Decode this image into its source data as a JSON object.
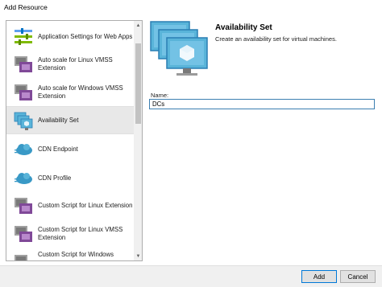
{
  "window": {
    "title": "Add Resource"
  },
  "resource_list": {
    "items": [
      {
        "label": "Application Settings for Web Apps",
        "icon": "app-settings-icon",
        "selected": false
      },
      {
        "label": "Auto scale for Linux VMSS Extension",
        "icon": "vmss-linux-icon",
        "selected": false
      },
      {
        "label": "Auto scale for Windows VMSS Extension",
        "icon": "vmss-windows-icon",
        "selected": false
      },
      {
        "label": "Availability Set",
        "icon": "availability-set-icon",
        "selected": true
      },
      {
        "label": "CDN Endpoint",
        "icon": "cdn-endpoint-icon",
        "selected": false
      },
      {
        "label": "CDN Profile",
        "icon": "cdn-profile-icon",
        "selected": false
      },
      {
        "label": "Custom Script for Linux Extension",
        "icon": "custom-script-linux-icon",
        "selected": false
      },
      {
        "label": "Custom Script for Linux VMSS Extension",
        "icon": "custom-script-vmss-icon",
        "selected": false
      },
      {
        "label": "Custom Script for Windows",
        "icon": "custom-script-windows-icon",
        "selected": false
      }
    ]
  },
  "details": {
    "title": "Availability Set",
    "description": "Create an availability set for virtual machines.",
    "name_label": "Name:",
    "name_value": "DCs"
  },
  "footer": {
    "add_label": "Add",
    "cancel_label": "Cancel"
  },
  "colors": {
    "accent": "#0078d7",
    "azure_blue": "#3999c6",
    "monitor_dark": "#59b4d9",
    "purple": "#804998",
    "selected_bg": "#e8e8e8"
  }
}
